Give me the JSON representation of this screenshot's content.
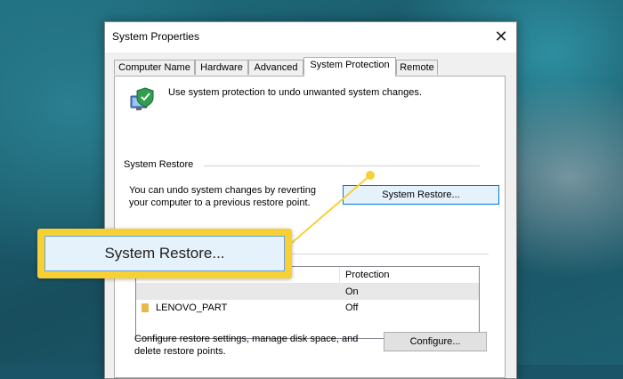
{
  "window": {
    "title": "System Properties"
  },
  "tabs": [
    {
      "label": "Computer Name"
    },
    {
      "label": "Hardware"
    },
    {
      "label": "Advanced"
    },
    {
      "label": "System Protection",
      "active": true
    },
    {
      "label": "Remote"
    }
  ],
  "intro": {
    "text": "Use system protection to undo unwanted system changes.",
    "icon": "system-protection-icon"
  },
  "system_restore": {
    "group_label": "System Restore",
    "description": "You can undo system changes by reverting your computer to a previous restore point.",
    "button_label": "System Restore..."
  },
  "protection": {
    "header_protection": "Protection",
    "rows": [
      {
        "name": "",
        "protection": "On",
        "selected": true
      },
      {
        "name": "LENOVO_PART",
        "protection": "Off",
        "selected": false
      }
    ]
  },
  "configure": {
    "description": "Configure restore settings, manage disk space, and delete restore points.",
    "button_label": "Configure..."
  },
  "callout": {
    "label": "System Restore..."
  },
  "colors": {
    "callout": "#f7d036",
    "focus_border": "#0078d7",
    "desktop": "#1a5466"
  }
}
